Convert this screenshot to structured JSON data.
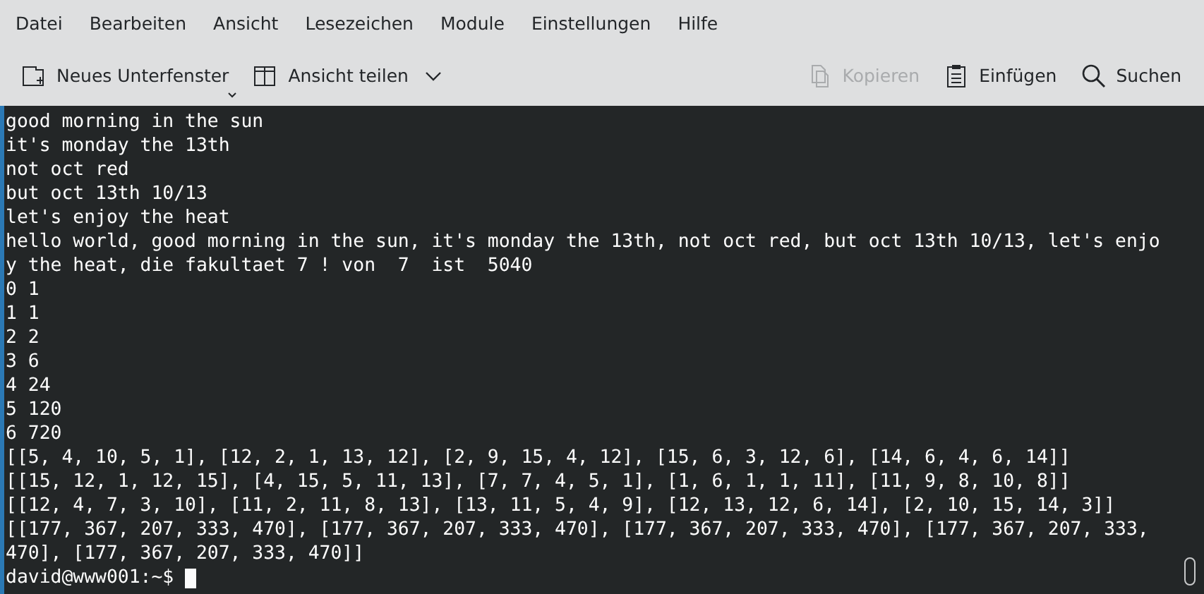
{
  "menu_bar": [
    "Datei",
    "Bearbeiten",
    "Ansicht",
    "Lesezeichen",
    "Module",
    "Einstellungen",
    "Hilfe"
  ],
  "toolbar": {
    "left": [
      {
        "label": "Neues Unterfenster",
        "kind": "corner-menu",
        "disabled": false
      },
      {
        "label": "Ansicht teilen",
        "kind": "split-menu",
        "disabled": false
      }
    ],
    "right": [
      {
        "label": "Kopieren",
        "disabled": true
      },
      {
        "label": "Einfügen",
        "disabled": false
      },
      {
        "label": "Suchen",
        "disabled": false
      }
    ]
  },
  "terminal": {
    "lines": [
      "good morning in the sun",
      "it's monday the 13th",
      "not oct red",
      "but oct 13th 10/13",
      "let's enjoy the heat",
      "hello world, good morning in the sun, it's monday the 13th, not oct red, but oct 13th 10/13, let's enjo",
      "y the heat, die fakultaet 7 ! von  7  ist  5040",
      "0 1",
      "1 1",
      "2 2",
      "3 6",
      "4 24",
      "5 120",
      "6 720",
      "[[5, 4, 10, 5, 1], [12, 2, 1, 13, 12], [2, 9, 15, 4, 12], [15, 6, 3, 12, 6], [14, 6, 4, 6, 14]]",
      "[[15, 12, 1, 12, 15], [4, 15, 5, 11, 13], [7, 7, 4, 5, 1], [1, 6, 1, 1, 11], [11, 9, 8, 10, 8]]",
      "[[12, 4, 7, 3, 10], [11, 2, 11, 8, 13], [13, 11, 5, 4, 9], [12, 13, 12, 6, 14], [2, 10, 15, 14, 3]]",
      "[[177, 367, 207, 333, 470], [177, 367, 207, 333, 470], [177, 367, 207, 333, 470], [177, 367, 207, 333,",
      "470], [177, 367, 207, 333, 470]]"
    ],
    "prompt": "david@www001:~$"
  }
}
